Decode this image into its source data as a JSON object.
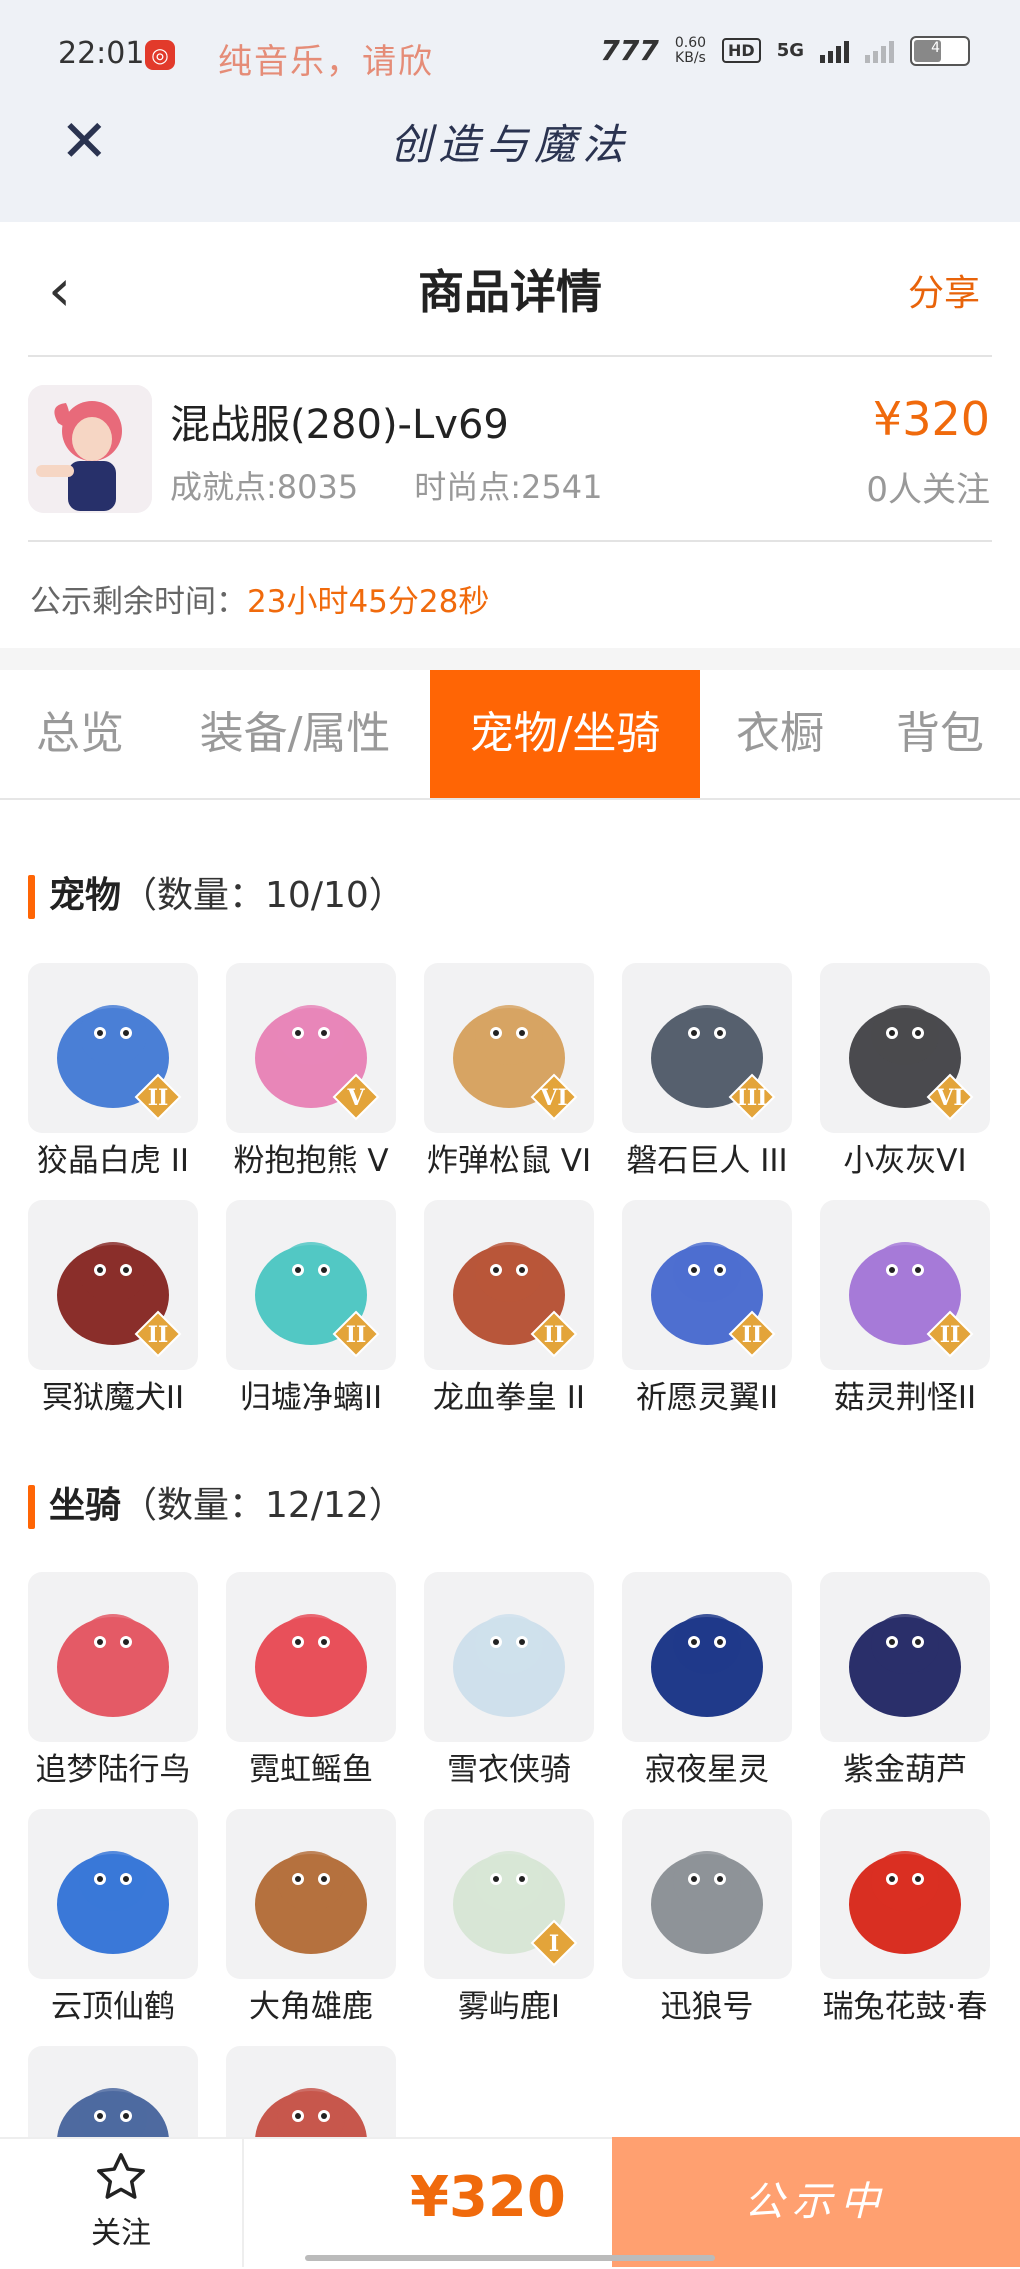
{
  "status_bar": {
    "time": "22:01",
    "notification": "纯音乐，请欣",
    "net_speed_value": "0.60",
    "net_speed_unit": "KB/s",
    "hd_label": "HD",
    "network": "5G",
    "battery": "48"
  },
  "app_bar": {
    "title": "创造与魔法"
  },
  "header": {
    "title": "商品详情",
    "share_label": "分享"
  },
  "product": {
    "name": "混战服(280)-Lv69",
    "achievement": "成就点:8035",
    "fashion": "时尚点:2541",
    "price": "¥320",
    "followers": "0人关注",
    "countdown_label": "公示剩余时间：",
    "countdown_value": "23小时45分28秒"
  },
  "tabs": [
    {
      "label": "总览",
      "active": false
    },
    {
      "label": "装备/属性",
      "active": false
    },
    {
      "label": "宠物/坐骑",
      "active": true
    },
    {
      "label": "衣橱",
      "active": false
    },
    {
      "label": "背包",
      "active": false
    }
  ],
  "pets_section": {
    "title": "宠物",
    "count": "（数量：10/10）",
    "items": [
      {
        "label": "狡晶白虎 II",
        "badge": "II",
        "color": "#4a7fd6"
      },
      {
        "label": "粉抱抱熊 V",
        "badge": "V",
        "color": "#e886b8"
      },
      {
        "label": "炸弹松鼠 VI",
        "badge": "VI",
        "color": "#d7a463"
      },
      {
        "label": "磐石巨人 III",
        "badge": "III",
        "color": "#56606e"
      },
      {
        "label": "小灰灰VI",
        "badge": "VI",
        "color": "#4a4a4e"
      },
      {
        "label": "冥狱魔犬II",
        "badge": "II",
        "color": "#8a2e2a"
      },
      {
        "label": "归墟净螭II",
        "badge": "II",
        "color": "#52c8c4"
      },
      {
        "label": "龙血拳皇 II",
        "badge": "II",
        "color": "#b8563a"
      },
      {
        "label": "祈愿灵翼II",
        "badge": "II",
        "color": "#4e6fd0"
      },
      {
        "label": "菇灵荆怪II",
        "badge": "II",
        "color": "#a67ad8"
      }
    ]
  },
  "mounts_section": {
    "title": "坐骑",
    "count": "（数量：12/12）",
    "items": [
      {
        "label": "追梦陆行鸟",
        "badge": "",
        "color": "#e45a66"
      },
      {
        "label": "霓虹鳐鱼",
        "badge": "",
        "color": "#e8505a"
      },
      {
        "label": "雪衣侠骑",
        "badge": "",
        "color": "#cfe0ec"
      },
      {
        "label": "寂夜星灵",
        "badge": "",
        "color": "#203a8a"
      },
      {
        "label": "紫金葫芦",
        "badge": "",
        "color": "#2a2f6a"
      },
      {
        "label": "云顶仙鹤",
        "badge": "",
        "color": "#3a78d8"
      },
      {
        "label": "大角雄鹿",
        "badge": "",
        "color": "#b5713e"
      },
      {
        "label": "雾屿鹿I",
        "badge": "I",
        "color": "#d8e6d6"
      },
      {
        "label": "迅狼号",
        "badge": "",
        "color": "#8e9398"
      },
      {
        "label": "瑞兔花鼓·春",
        "badge": "",
        "color": "#d92f22"
      },
      {
        "label": "",
        "badge": "",
        "color": "#4e6aa0"
      },
      {
        "label": "",
        "badge": "",
        "color": "#c7574c"
      }
    ]
  },
  "bottom_bar": {
    "favorite_label": "关注",
    "price": "¥320",
    "status_label": "公示中"
  }
}
